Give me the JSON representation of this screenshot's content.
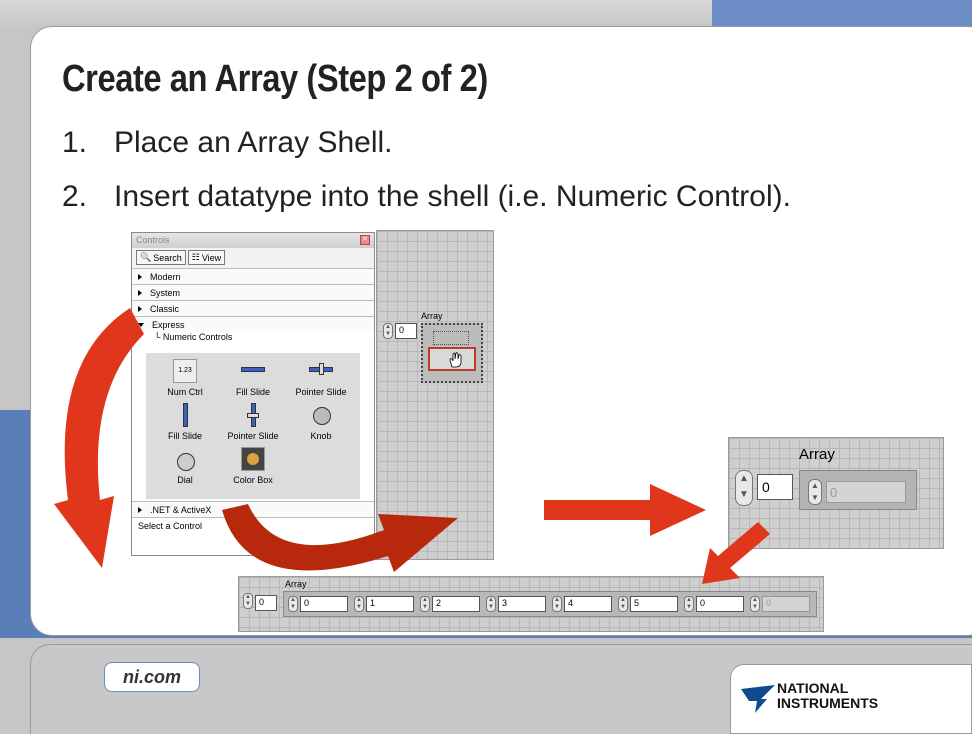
{
  "slide": {
    "title": "Create an Array (Step 2 of 2)",
    "steps": [
      {
        "num": "1.",
        "text": "Place an Array Shell."
      },
      {
        "num": "2.",
        "text": "Insert datatype into the shell (i.e. Numeric Control)."
      }
    ],
    "footer_link": "ni.com",
    "logo_line1": "NATIONAL",
    "logo_line2": "INSTRUMENTS"
  },
  "palette": {
    "title": "Controls",
    "search_label": "Search",
    "view_label": "View",
    "categories": [
      "Modern",
      "System",
      "Classic",
      "Express"
    ],
    "subcategory": "Numeric Controls",
    "controls": [
      "Num Ctrl",
      "Fill Slide",
      "Pointer Slide",
      "Fill Slide",
      "Pointer Slide",
      "Knob",
      "Dial",
      "Color Box"
    ],
    "net_row": ".NET & ActiveX",
    "status": "Select a Control"
  },
  "panel1": {
    "array_label": "Array",
    "index_value": "0"
  },
  "panel2": {
    "array_label": "Array",
    "index_value": "0",
    "element_value": "0"
  },
  "panel3": {
    "array_label": "Array",
    "index_value": "0",
    "elements": [
      "0",
      "1",
      "2",
      "3",
      "4",
      "5",
      "0",
      "0"
    ]
  },
  "colors": {
    "accent_blue": "#5a7fb8",
    "arrow_red": "#e0361c"
  }
}
